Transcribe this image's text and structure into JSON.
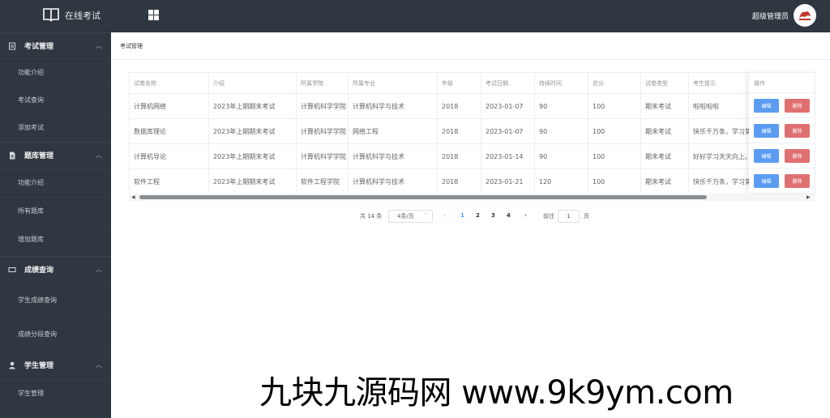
{
  "header": {
    "title": "在线考试",
    "user_name": "超级管理员",
    "menu_toggle_icon": "grid-icon",
    "book_icon": "book-icon"
  },
  "sidebar": {
    "groups": [
      {
        "title": "考试管理",
        "icon": "document-icon",
        "items": [
          "功能介绍",
          "考试查询",
          "添加考试"
        ]
      },
      {
        "title": "题库管理",
        "icon": "file-icon",
        "items": [
          "功能介绍",
          "所有题库",
          "增加题库"
        ]
      },
      {
        "title": "成绩查询",
        "icon": "monitor-icon",
        "items": [
          "学生成绩查询",
          "成绩分段查询"
        ]
      },
      {
        "title": "学生管理",
        "icon": "user-icon",
        "items": [
          "学生管理"
        ]
      }
    ]
  },
  "breadcrumb": {
    "current": "考试管理"
  },
  "table": {
    "columns": [
      "试卷名称",
      "介绍",
      "所属学院",
      "所属专业",
      "年级",
      "考试日期",
      "持续时间",
      "总分",
      "试卷类型",
      "考生提示"
    ],
    "operation_header": "操作",
    "edit_label": "编辑",
    "delete_label": "删除",
    "rows": [
      [
        "计算机网络",
        "2023年上期期末考试",
        "计算机科学学院",
        "计算机科学与技术",
        "2018",
        "2023-01-07",
        "90",
        "100",
        "期末考试",
        "啦啦啦啦"
      ],
      [
        "数据库理论",
        "2023年上期期末考试",
        "计算机科学学院",
        "网络工程",
        "2018",
        "2023-01-07",
        "90",
        "100",
        "期末考试",
        "快乐千万条，学习第一"
      ],
      [
        "计算机导论",
        "2023年上期期末考试",
        "计算机科学学院",
        "计算机科学与技术",
        "2018",
        "2023-01-14",
        "90",
        "100",
        "期末考试",
        "好好学习天天向上。"
      ],
      [
        "软件工程",
        "2023年上期期末考试",
        "软件工程学院",
        "计算机科学与技术",
        "2018",
        "2023-01-21",
        "120",
        "100",
        "期末考试",
        "快乐千万条，学习第一"
      ]
    ]
  },
  "pagination": {
    "total": "共 14 条",
    "page_size": "4条/页",
    "pages": [
      "1",
      "2",
      "3",
      "4"
    ],
    "current_page": "1",
    "goto_label": "前往",
    "goto_value": "1",
    "page_unit": "页"
  },
  "watermark": "九块九源码网 www.9k9ym.com"
}
